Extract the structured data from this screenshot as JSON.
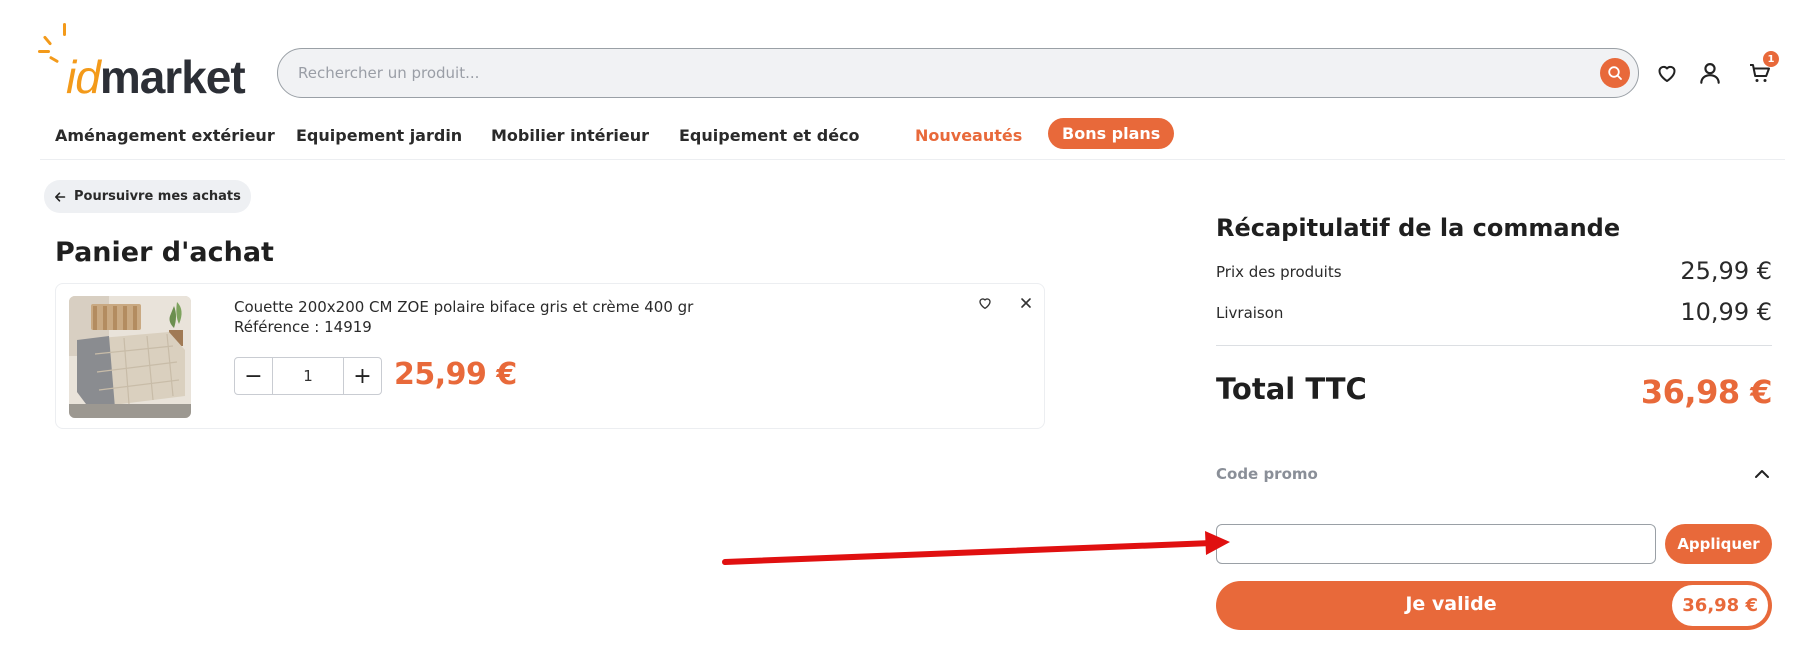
{
  "brand": {
    "logo_part1": "id",
    "logo_part2": "market",
    "accent_color": "#e8693a"
  },
  "search": {
    "placeholder": "Rechercher un produit...",
    "icon": "search-icon"
  },
  "header_icons": {
    "wishlist": "heart-icon",
    "account": "user-icon",
    "cart": "cart-icon",
    "cart_count": "1"
  },
  "nav": {
    "items": [
      {
        "label": "Aménagement extérieur"
      },
      {
        "label": "Equipement jardin"
      },
      {
        "label": "Mobilier intérieur"
      },
      {
        "label": "Equipement et déco"
      },
      {
        "label": "Nouveautés"
      },
      {
        "label": "Bons plans"
      }
    ]
  },
  "back_button": {
    "label": "Poursuivre mes achats",
    "icon": "arrow-left-icon"
  },
  "cart": {
    "title": "Panier d'achat",
    "items": [
      {
        "name": "Couette 200x200 CM ZOE polaire biface gris et crème 400 gr",
        "reference": "Référence : 14919",
        "quantity": "1",
        "price": "25,99 €",
        "minus": "−",
        "plus": "+"
      }
    ]
  },
  "summary": {
    "title": "Récapitulatif de la commande",
    "products_label": "Prix des produits",
    "products_value": "25,99 €",
    "shipping_label": "Livraison",
    "shipping_value": "10,99 €",
    "total_label": "Total TTC",
    "total_value": "36,98 €",
    "promo_label": "Code promo",
    "promo_input_value": "",
    "apply_label": "Appliquer",
    "validate_label": "Je valide",
    "validate_price": "36,98 €"
  },
  "annotation": {
    "arrow_color": "#e01010"
  }
}
